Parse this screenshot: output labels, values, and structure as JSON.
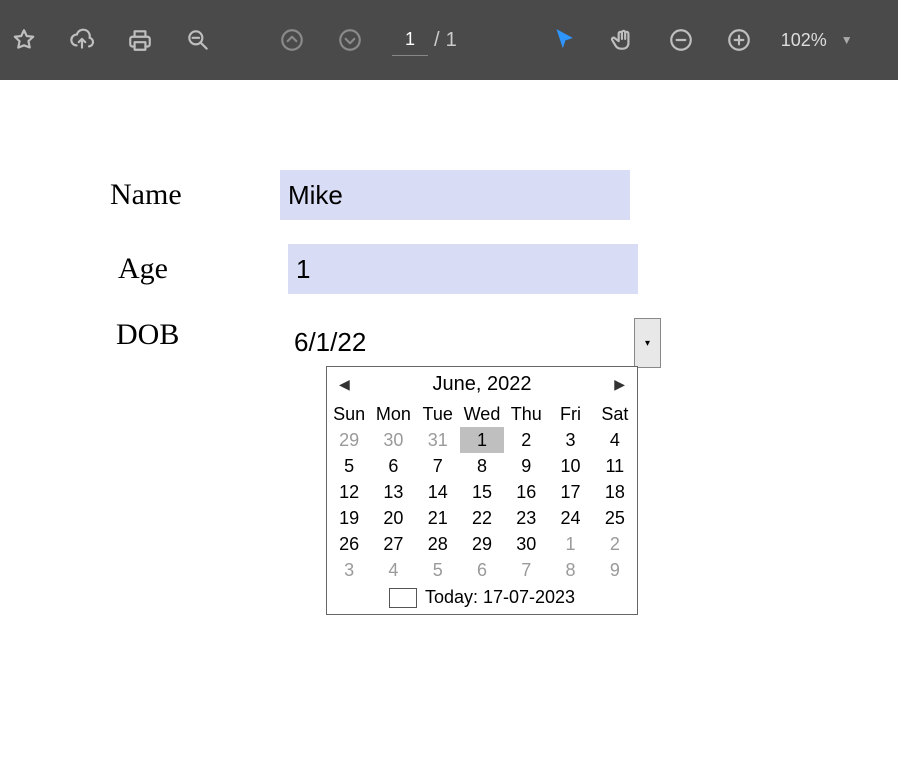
{
  "toolbar": {
    "page_current": "1",
    "page_sep": "/",
    "page_total": "1",
    "zoom": "102%"
  },
  "form": {
    "name_label": "Name",
    "name_value": "Mike",
    "age_label": "Age",
    "age_value": "1",
    "dob_label": "DOB",
    "dob_value": "6/1/22"
  },
  "calendar": {
    "title": "June, 2022",
    "dow": [
      "Sun",
      "Mon",
      "Tue",
      "Wed",
      "Thu",
      "Fri",
      "Sat"
    ],
    "weeks": [
      [
        {
          "d": "29",
          "grey": true
        },
        {
          "d": "30",
          "grey": true
        },
        {
          "d": "31",
          "grey": true
        },
        {
          "d": "1",
          "sel": true
        },
        {
          "d": "2"
        },
        {
          "d": "3"
        },
        {
          "d": "4"
        }
      ],
      [
        {
          "d": "5"
        },
        {
          "d": "6"
        },
        {
          "d": "7"
        },
        {
          "d": "8"
        },
        {
          "d": "9"
        },
        {
          "d": "10"
        },
        {
          "d": "11"
        }
      ],
      [
        {
          "d": "12"
        },
        {
          "d": "13"
        },
        {
          "d": "14"
        },
        {
          "d": "15"
        },
        {
          "d": "16"
        },
        {
          "d": "17"
        },
        {
          "d": "18"
        }
      ],
      [
        {
          "d": "19"
        },
        {
          "d": "20"
        },
        {
          "d": "21"
        },
        {
          "d": "22"
        },
        {
          "d": "23"
        },
        {
          "d": "24"
        },
        {
          "d": "25"
        }
      ],
      [
        {
          "d": "26"
        },
        {
          "d": "27"
        },
        {
          "d": "28"
        },
        {
          "d": "29"
        },
        {
          "d": "30"
        },
        {
          "d": "1",
          "grey": true
        },
        {
          "d": "2",
          "grey": true
        }
      ],
      [
        {
          "d": "3",
          "grey": true
        },
        {
          "d": "4",
          "grey": true
        },
        {
          "d": "5",
          "grey": true
        },
        {
          "d": "6",
          "grey": true
        },
        {
          "d": "7",
          "grey": true
        },
        {
          "d": "8",
          "grey": true
        },
        {
          "d": "9",
          "grey": true
        }
      ]
    ],
    "today": "Today: 17-07-2023"
  }
}
